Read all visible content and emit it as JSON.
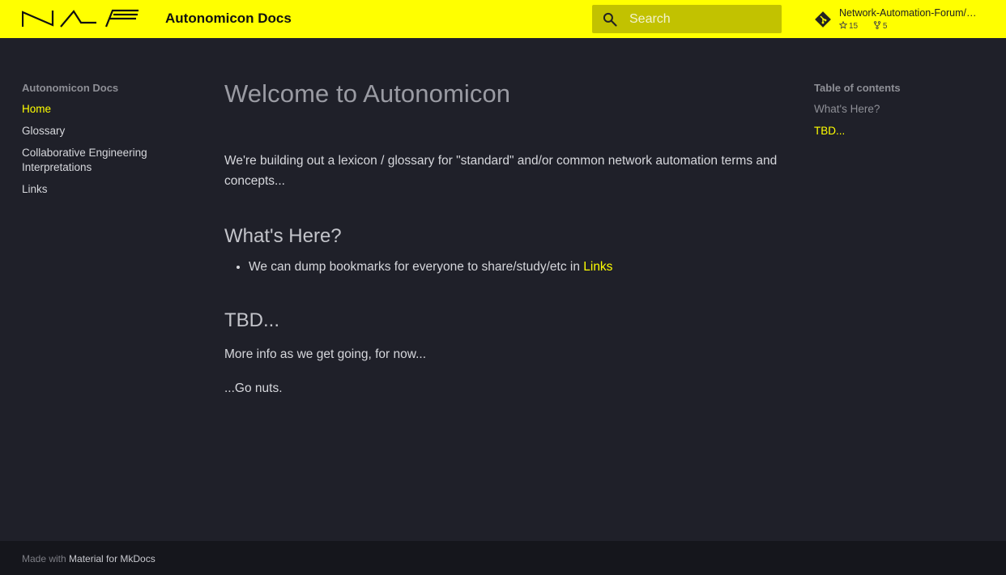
{
  "header": {
    "logo_icon": "naf-logo-icon",
    "site_title": "Autonomicon Docs",
    "search": {
      "placeholder": "Search",
      "icon": "search-icon"
    },
    "repo": {
      "icon": "git-icon",
      "name": "Network-Automation-Forum/autonomicon",
      "stars": "15",
      "forks": "5"
    }
  },
  "nav": {
    "title": "Autonomicon Docs",
    "items": [
      {
        "label": "Home",
        "active": true
      },
      {
        "label": "Glossary"
      },
      {
        "label": "Collaborative Engineering Interpretations"
      },
      {
        "label": "Links"
      }
    ]
  },
  "content": {
    "title": "Welcome to Autonomicon",
    "intro": "We're building out a lexicon / glossary for \"standard\" and/or common network automation terms and concepts...",
    "section1_heading": "What's Here?",
    "bullet_text": "We can dump bookmarks for everyone to share/study/etc in ",
    "bullet_link": "Links",
    "section2_heading": "TBD...",
    "para2": "More info as we get going, for now...",
    "para3": "...Go nuts."
  },
  "toc": {
    "title": "Table of contents",
    "items": [
      {
        "label": "What's Here?"
      },
      {
        "label": "TBD...",
        "active": true
      }
    ]
  },
  "footer": {
    "prefix": "Made with",
    "link": "Material for MkDocs"
  },
  "colors": {
    "accent": "#ffff00",
    "background": "#1f2029",
    "footer": "#15161c"
  }
}
